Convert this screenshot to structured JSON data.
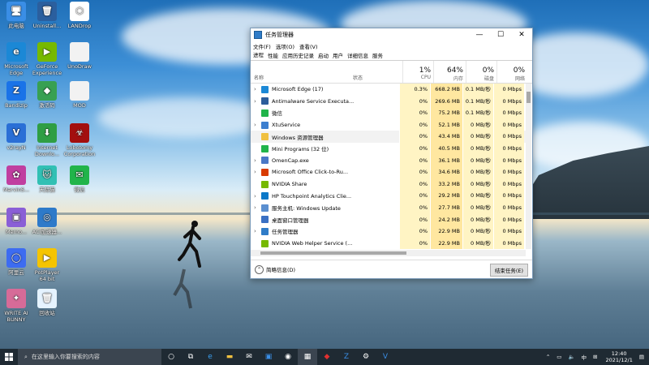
{
  "desktop_icons": [
    {
      "label": "此电脑",
      "color": "#3a8ee6",
      "glyph": "🖥"
    },
    {
      "label": "Uninstall...",
      "color": "#2b5f9e",
      "glyph": "🗑"
    },
    {
      "label": "LANDrop",
      "color": "#ffffff",
      "glyph": "⬡"
    },
    {
      "label": "Microsoft Edge",
      "color": "#1b88d6",
      "glyph": "e"
    },
    {
      "label": "GeForce Experience",
      "color": "#76b900",
      "glyph": "▶"
    },
    {
      "label": "UnoDraw",
      "color": "#f2f2f2",
      "glyph": ""
    },
    {
      "label": "Bandizip",
      "color": "#1a73e8",
      "glyph": "Z"
    },
    {
      "label": "激活码",
      "color": "#38a052",
      "glyph": "◆"
    },
    {
      "label": "MOD",
      "color": "#f2f2f2",
      "glyph": ""
    },
    {
      "label": "v2rayN",
      "color": "#2a6fd6",
      "glyph": "V"
    },
    {
      "label": "Internet Downlo...",
      "color": "#2f9e44",
      "glyph": "⬇"
    },
    {
      "label": "Lobotomy Corporation",
      "color": "#a30f0f",
      "glyph": "☣"
    },
    {
      "label": "MarvinS...",
      "color": "#c03fa0",
      "glyph": "✿"
    },
    {
      "label": "天际猫",
      "color": "#31c0b4",
      "glyph": "🐱"
    },
    {
      "label": "微信",
      "color": "#21b44a",
      "glyph": "✉"
    },
    {
      "label": "Memo...",
      "color": "#8a5fd6",
      "glyph": "▣"
    },
    {
      "label": "ACI加速器...",
      "color": "#2e7ac9",
      "glyph": "◎"
    },
    {
      "label": "阿里云",
      "color": "#3d6cf1",
      "glyph": "◯"
    },
    {
      "label": "PotPlayer 64 bit",
      "color": "#f5c400",
      "glyph": "▶"
    },
    {
      "label": "WRITE AI BUNNY",
      "color": "#d66b98",
      "glyph": "✦"
    },
    {
      "label": "回收站",
      "color": "#e5f3ff",
      "glyph": "🗑"
    }
  ],
  "task_manager": {
    "title": "任务管理器",
    "menu": [
      "文件(F)",
      "选项(O)",
      "查看(V)"
    ],
    "tabs": [
      "进程",
      "性能",
      "应用历史记录",
      "启动",
      "用户",
      "详细信息",
      "服务"
    ],
    "columns": {
      "name": "名称",
      "status": "状态",
      "cpu": {
        "pct": "1%",
        "label": "CPU"
      },
      "mem": {
        "pct": "64%",
        "label": "内存"
      },
      "disk": {
        "pct": "0%",
        "label": "磁盘"
      },
      "net": {
        "pct": "0%",
        "label": "网络"
      }
    },
    "rows": [
      {
        "name": "Microsoft Edge (17)",
        "cpu": "0.3%",
        "mem": "668.2 MB",
        "disk": "0.1 MB/秒",
        "net": "0 Mbps",
        "icon_color": "#1b88d6",
        "expandable": true
      },
      {
        "name": "Antimalware Service Executa...",
        "cpu": "0%",
        "mem": "269.6 MB",
        "disk": "0.1 MB/秒",
        "net": "0 Mbps",
        "icon_color": "#2c5d9b",
        "expandable": true
      },
      {
        "name": "微信",
        "cpu": "0%",
        "mem": "75.2 MB",
        "disk": "0.1 MB/秒",
        "net": "0 Mbps",
        "icon_color": "#21b44a",
        "expandable": false
      },
      {
        "name": "XtuService",
        "cpu": "0%",
        "mem": "52.1 MB",
        "disk": "0 MB/秒",
        "net": "0 Mbps",
        "icon_color": "#3d7fcf",
        "expandable": true
      },
      {
        "name": "Windows 资源管理器",
        "cpu": "0%",
        "mem": "43.4 MB",
        "disk": "0 MB/秒",
        "net": "0 Mbps",
        "icon_color": "#f0c040",
        "expandable": false
      },
      {
        "name": "Mini Programs (32 位)",
        "cpu": "0%",
        "mem": "40.5 MB",
        "disk": "0 MB/秒",
        "net": "0 Mbps",
        "icon_color": "#21b44a",
        "expandable": false
      },
      {
        "name": "OmenCap.exe",
        "cpu": "0%",
        "mem": "36.1 MB",
        "disk": "0 MB/秒",
        "net": "0 Mbps",
        "icon_color": "#4a78c6",
        "expandable": true
      },
      {
        "name": "Microsoft Office Click-to-Ru...",
        "cpu": "0%",
        "mem": "34.6 MB",
        "disk": "0 MB/秒",
        "net": "0 Mbps",
        "icon_color": "#d83b01",
        "expandable": true
      },
      {
        "name": "NVIDIA Share",
        "cpu": "0%",
        "mem": "33.2 MB",
        "disk": "0 MB/秒",
        "net": "0 Mbps",
        "icon_color": "#76b900",
        "expandable": false
      },
      {
        "name": "HP Touchpoint Analytics Clie...",
        "cpu": "0%",
        "mem": "29.2 MB",
        "disk": "0 MB/秒",
        "net": "0 Mbps",
        "icon_color": "#0a78c8",
        "expandable": true
      },
      {
        "name": "服务主机: Windows Update",
        "cpu": "0%",
        "mem": "27.7 MB",
        "disk": "0 MB/秒",
        "net": "0 Mbps",
        "icon_color": "#5b8fd0",
        "expandable": true
      },
      {
        "name": "桌面窗口管理器",
        "cpu": "0%",
        "mem": "24.2 MB",
        "disk": "0 MB/秒",
        "net": "0 Mbps",
        "icon_color": "#3a70c4",
        "expandable": false
      },
      {
        "name": "任务管理器",
        "cpu": "0%",
        "mem": "22.9 MB",
        "disk": "0 MB/秒",
        "net": "0 Mbps",
        "icon_color": "#2f7cc8",
        "expandable": true
      },
      {
        "name": "NVIDIA Web Helper Service (...",
        "cpu": "0%",
        "mem": "22.9 MB",
        "disk": "0 MB/秒",
        "net": "0 Mbps",
        "icon_color": "#76b900",
        "expandable": false
      }
    ],
    "footer": {
      "less_details": "简略信息(D)",
      "end_task": "结束任务(E)"
    }
  },
  "taskbar": {
    "search_placeholder": "在这里输入你要搜索的内容",
    "ime": "中",
    "time": "12:40",
    "date": "2021/12/1"
  }
}
